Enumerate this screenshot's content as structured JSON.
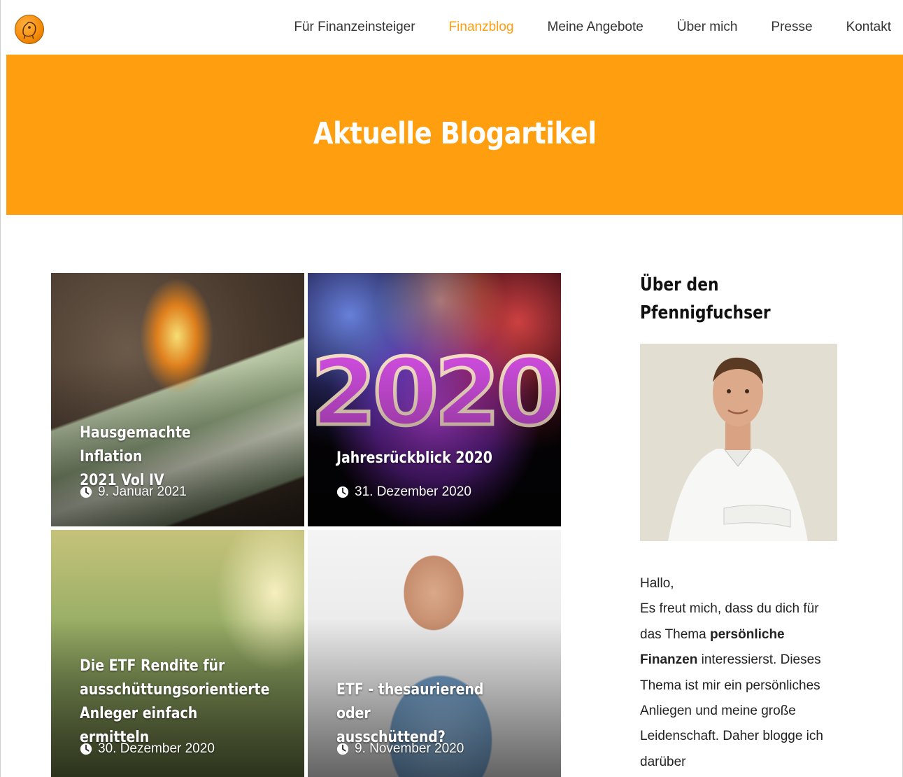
{
  "nav": {
    "items": [
      {
        "label": "Für Finanzeinsteiger",
        "active": false
      },
      {
        "label": "Finanzblog",
        "active": true
      },
      {
        "label": "Meine Angebote",
        "active": false
      },
      {
        "label": "Über mich",
        "active": false
      },
      {
        "label": "Presse",
        "active": false
      },
      {
        "label": "Kontakt",
        "active": false
      }
    ]
  },
  "hero": {
    "title": "Aktuelle Blogartikel"
  },
  "posts": [
    {
      "title": "Hausgemachte Inflation\n2021 Vol IV",
      "date": "9. Januar 2021"
    },
    {
      "title": "Jahresrückblick 2020",
      "date": "31. Dezember 2020",
      "image_text": "2020"
    },
    {
      "title": "Die ETF Rendite für\nausschüttungsorientierte\nAnleger einfach ermitteln",
      "date": "30. Dezember 2020"
    },
    {
      "title": "ETF - thesaurierend oder\nausschüttend?",
      "date": "9. November 2020"
    }
  ],
  "sidebar": {
    "heading": "Über den\nPfennigfuchser",
    "greeting": "Hallo,",
    "intro_before": "Es freut mich, dass du dich für das Thema ",
    "intro_bold": "persönliche Finanzen",
    "intro_after": " interessierst. Dieses Thema ist mir ein persönliches Anliegen und meine große Leidenschaft. Daher blogge ich darüber"
  },
  "colors": {
    "accent": "#ff9e0f",
    "text": "#333333"
  },
  "icons": {
    "date": "clock-icon",
    "logo": "piggy-logo"
  }
}
